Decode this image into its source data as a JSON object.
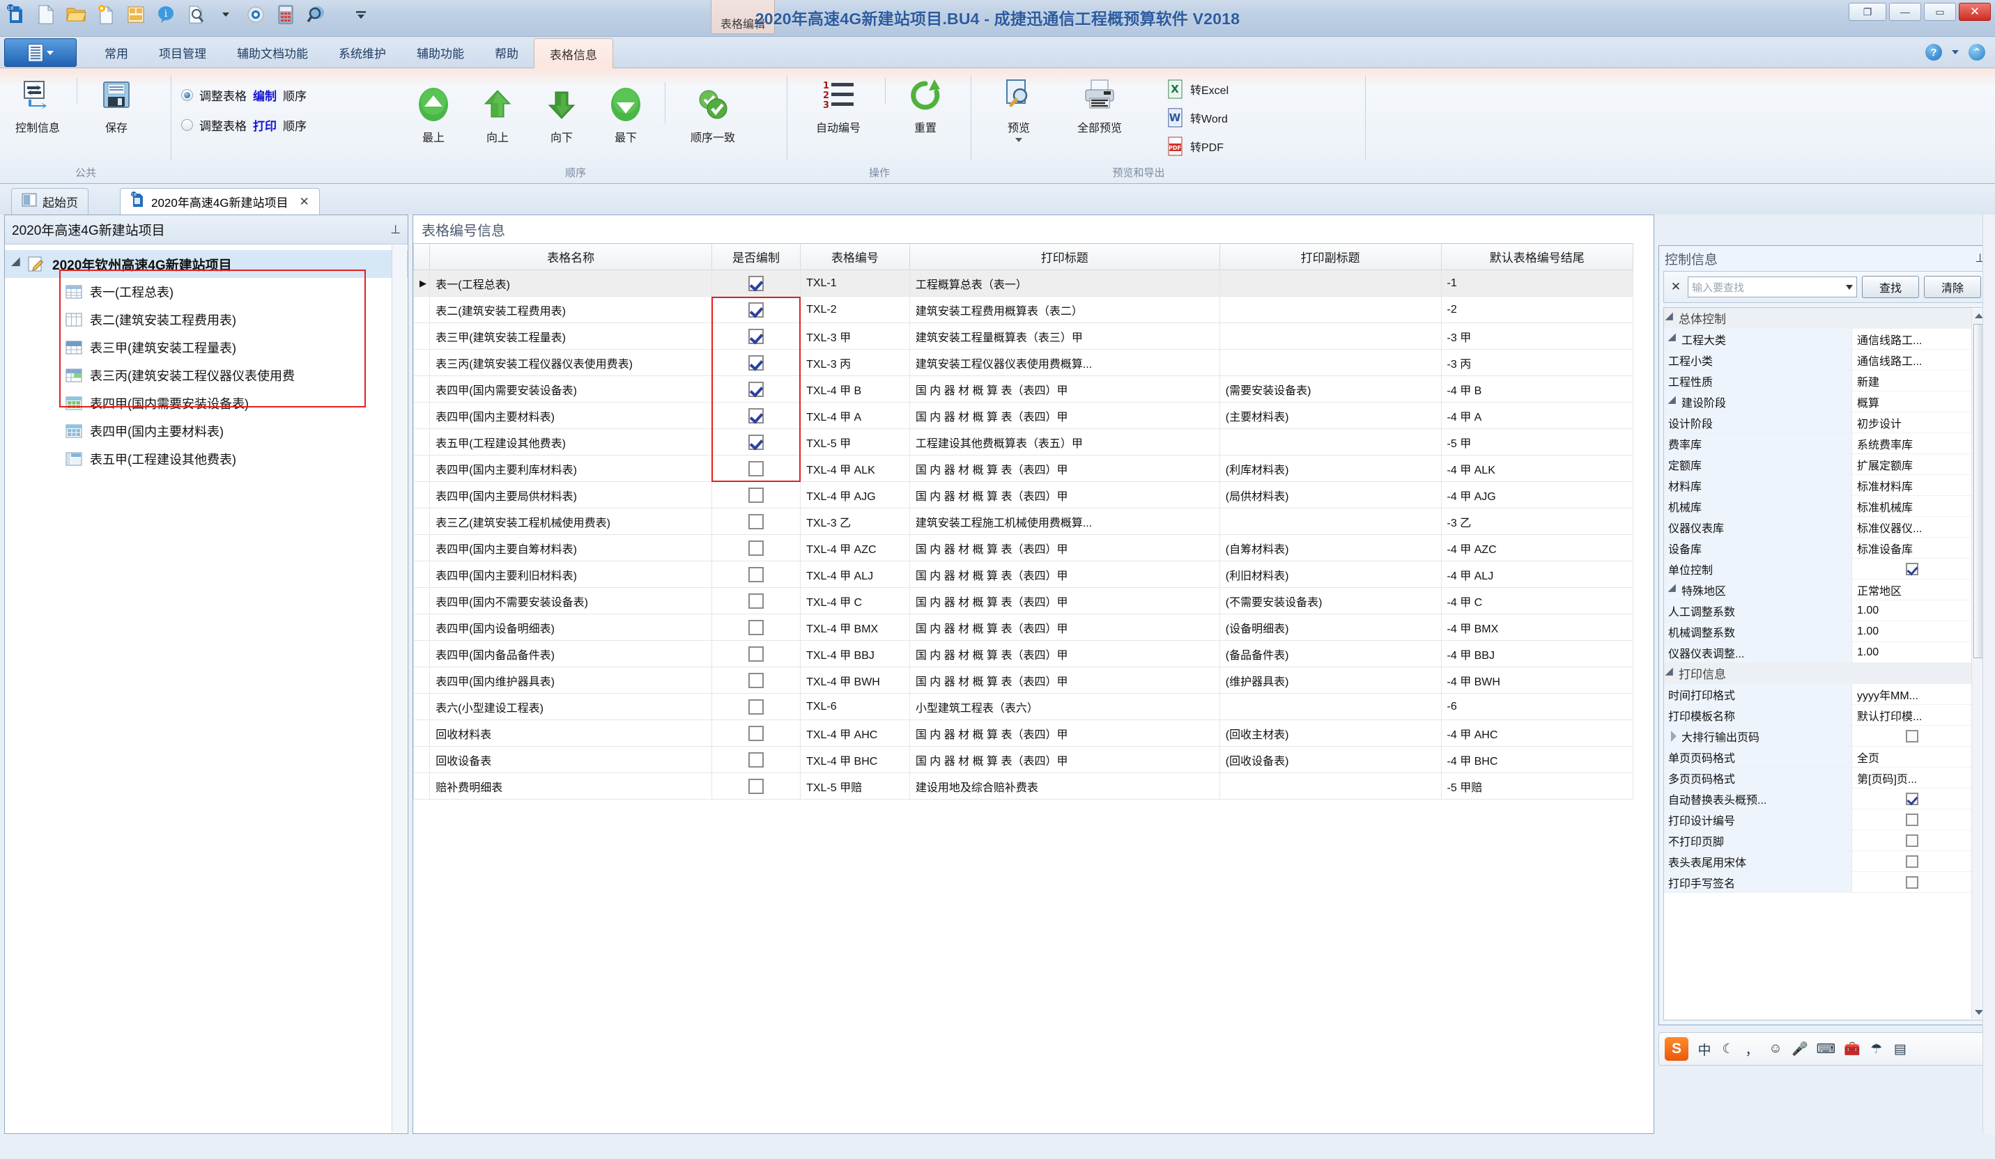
{
  "window": {
    "title": "2020年高速4G新建站项目.BU4 - 成捷迅通信工程概预算软件 V2018",
    "doc_tab_top": "表格编辑",
    "buttons": {
      "minimize": "—",
      "restore": "❐",
      "maximize": "▭",
      "close": "✕"
    }
  },
  "quick_access": {
    "icons": [
      "app-logo-icon",
      "new-file-icon",
      "open-folder-icon",
      "new-project-icon",
      "template-icon",
      "info-bubble-icon",
      "find-doc-icon",
      "dropdown-caret-icon",
      "settings-gear-icon",
      "calculator-icon",
      "search-magnifier-icon",
      "qat-more-icon"
    ]
  },
  "ribbon": {
    "tabs": [
      {
        "label": "常用",
        "active": false
      },
      {
        "label": "项目管理",
        "active": false
      },
      {
        "label": "辅助文档功能",
        "active": false
      },
      {
        "label": "系统维护",
        "active": false
      },
      {
        "label": "辅助功能",
        "active": false
      },
      {
        "label": "帮助",
        "active": false
      },
      {
        "label": "表格信息",
        "active": true
      }
    ],
    "help_icons": [
      "help-icon",
      "dropdown-caret-icon",
      "pin-ribbon-icon"
    ],
    "groups": [
      {
        "name": "公共",
        "buttons": [
          {
            "label": "控制信息",
            "icon": "control-info-icon"
          },
          {
            "label": "保存",
            "icon": "save-floppy-icon"
          }
        ]
      },
      {
        "name": "顺序",
        "radios": [
          {
            "prefix": "调整表格",
            "highlight": "编制",
            "suffix": "顺序",
            "checked": true
          },
          {
            "prefix": "调整表格",
            "highlight": "打印",
            "suffix": "顺序",
            "checked": false
          }
        ],
        "buttons": [
          {
            "label": "最上",
            "icon": "move-top-icon"
          },
          {
            "label": "向上",
            "icon": "move-up-icon"
          },
          {
            "label": "向下",
            "icon": "move-down-icon"
          },
          {
            "label": "最下",
            "icon": "move-bottom-icon"
          },
          {
            "label": "顺序一致",
            "icon": "sync-order-icon"
          }
        ]
      },
      {
        "name": "操作",
        "buttons": [
          {
            "label": "自动编号",
            "icon": "auto-number-icon"
          },
          {
            "label": "重置",
            "icon": "reset-refresh-icon"
          }
        ]
      },
      {
        "name": "预览和导出",
        "buttons": [
          {
            "label": "预览",
            "icon": "preview-icon"
          },
          {
            "label": "全部预览",
            "icon": "preview-all-printer-icon"
          }
        ],
        "exports": [
          {
            "label": "转Excel",
            "icon": "excel-icon"
          },
          {
            "label": "转Word",
            "icon": "word-icon"
          },
          {
            "label": "转PDF",
            "icon": "pdf-icon"
          }
        ]
      }
    ]
  },
  "doc_tabs": [
    {
      "label": "起始页",
      "icon": "start-page-icon",
      "active": false,
      "closable": false
    },
    {
      "label": "2020年高速4G新建站项目",
      "icon": "project-icon",
      "active": true,
      "closable": true,
      "close_glyph": "✕"
    }
  ],
  "left_panel": {
    "header": "2020年高速4G新建站项目",
    "pin_glyph": "⊥",
    "root": {
      "label": "2020年钦州高速4G新建站项目",
      "icon": "project-edit-icon"
    },
    "items": [
      {
        "label": "表一(工程总表)",
        "icon": "table-grid-blue-icon"
      },
      {
        "label": "表二(建筑安装工程费用表)",
        "icon": "table-columns-icon"
      },
      {
        "label": "表三甲(建筑安装工程量表)",
        "icon": "table-header-blue-icon"
      },
      {
        "label": "表三丙(建筑安装工程仪器仪表使用费",
        "icon": "table-mixed-green-icon"
      },
      {
        "label": "表四甲(国内需要安装设备表)",
        "icon": "table-green-icon"
      },
      {
        "label": "表四甲(国内主要材料表)",
        "icon": "table-blue-icon"
      },
      {
        "label": "表五甲(工程建设其他费表)",
        "icon": "table-form-icon"
      }
    ]
  },
  "grid": {
    "title": "表格编号信息",
    "columns": [
      "",
      "表格名称",
      "是否编制",
      "表格编号",
      "打印标题",
      "打印副标题",
      "默认表格编号结尾"
    ],
    "rows": [
      {
        "ind": "▶",
        "name": "表一(工程总表)",
        "checked": true,
        "num": "TXL-1",
        "title": "工程概算总表（表一）",
        "sub": "",
        "tail": "-1",
        "selected": true
      },
      {
        "ind": "",
        "name": "表二(建筑安装工程费用表)",
        "checked": true,
        "num": "TXL-2",
        "title": "建筑安装工程费用概算表（表二）",
        "sub": "",
        "tail": "-2",
        "selected": false
      },
      {
        "ind": "",
        "name": "表三甲(建筑安装工程量表)",
        "checked": true,
        "num": "TXL-3 甲",
        "title": "建筑安装工程量概算表（表三）甲",
        "sub": "",
        "tail": "-3 甲",
        "selected": false
      },
      {
        "ind": "",
        "name": "表三丙(建筑安装工程仪器仪表使用费表)",
        "checked": true,
        "num": "TXL-3 丙",
        "title": "建筑安装工程仪器仪表使用费概算...",
        "sub": "",
        "tail": "-3 丙",
        "selected": false
      },
      {
        "ind": "",
        "name": "表四甲(国内需要安装设备表)",
        "checked": true,
        "num": "TXL-4 甲 B",
        "title": "国 内 器 材 概 算 表（表四）甲",
        "sub": "(需要安装设备表)",
        "tail": "-4 甲 B",
        "selected": false
      },
      {
        "ind": "",
        "name": "表四甲(国内主要材料表)",
        "checked": true,
        "num": "TXL-4 甲 A",
        "title": "国 内 器 材 概 算 表（表四）甲",
        "sub": "(主要材料表)",
        "tail": "-4 甲 A",
        "selected": false
      },
      {
        "ind": "",
        "name": "表五甲(工程建设其他费表)",
        "checked": true,
        "num": "TXL-5 甲",
        "title": "工程建设其他费概算表（表五）甲",
        "sub": "",
        "tail": "-5 甲",
        "selected": false
      },
      {
        "ind": "",
        "name": "表四甲(国内主要利库材料表)",
        "checked": false,
        "num": "TXL-4 甲 ALK",
        "title": "国 内 器 材 概 算 表（表四）甲",
        "sub": "(利库材料表)",
        "tail": "-4 甲 ALK",
        "selected": false
      },
      {
        "ind": "",
        "name": "表四甲(国内主要局供材料表)",
        "checked": false,
        "num": "TXL-4 甲 AJG",
        "title": "国 内 器 材 概 算 表（表四）甲",
        "sub": "(局供材料表)",
        "tail": "-4 甲 AJG",
        "selected": false
      },
      {
        "ind": "",
        "name": "表三乙(建筑安装工程机械使用费表)",
        "checked": false,
        "num": "TXL-3 乙",
        "title": "建筑安装工程施工机械使用费概算...",
        "sub": "",
        "tail": "-3 乙",
        "selected": false
      },
      {
        "ind": "",
        "name": "表四甲(国内主要自筹材料表)",
        "checked": false,
        "num": "TXL-4 甲 AZC",
        "title": "国 内 器 材 概 算 表（表四）甲",
        "sub": "(自筹材料表)",
        "tail": "-4 甲 AZC",
        "selected": false
      },
      {
        "ind": "",
        "name": "表四甲(国内主要利旧材料表)",
        "checked": false,
        "num": "TXL-4 甲 ALJ",
        "title": "国 内 器 材 概 算 表（表四）甲",
        "sub": "(利旧材料表)",
        "tail": "-4 甲 ALJ",
        "selected": false
      },
      {
        "ind": "",
        "name": "表四甲(国内不需要安装设备表)",
        "checked": false,
        "num": "TXL-4 甲 C",
        "title": "国 内 器 材 概 算 表（表四）甲",
        "sub": "(不需要安装设备表)",
        "tail": "-4 甲 C",
        "selected": false
      },
      {
        "ind": "",
        "name": "表四甲(国内设备明细表)",
        "checked": false,
        "num": "TXL-4 甲 BMX",
        "title": "国 内 器 材 概 算 表（表四）甲",
        "sub": "(设备明细表)",
        "tail": "-4 甲 BMX",
        "selected": false
      },
      {
        "ind": "",
        "name": "表四甲(国内备品备件表)",
        "checked": false,
        "num": "TXL-4 甲 BBJ",
        "title": "国 内 器 材 概 算 表（表四）甲",
        "sub": "(备品备件表)",
        "tail": "-4 甲 BBJ",
        "selected": false
      },
      {
        "ind": "",
        "name": "表四甲(国内维护器具表)",
        "checked": false,
        "num": "TXL-4 甲 BWH",
        "title": "国 内 器 材 概 算 表（表四）甲",
        "sub": "(维护器具表)",
        "tail": "-4 甲 BWH",
        "selected": false
      },
      {
        "ind": "",
        "name": "表六(小型建设工程表)",
        "checked": false,
        "num": "TXL-6",
        "title": "小型建筑工程表（表六）",
        "sub": "",
        "tail": "-6",
        "selected": false
      },
      {
        "ind": "",
        "name": "回收材料表",
        "checked": false,
        "num": "TXL-4 甲 AHC",
        "title": "国 内 器 材 概 算 表（表四）甲",
        "sub": "(回收主材表)",
        "tail": "-4 甲 AHC",
        "selected": false
      },
      {
        "ind": "",
        "name": "回收设备表",
        "checked": false,
        "num": "TXL-4 甲 BHC",
        "title": "国 内 器 材 概 算 表（表四）甲",
        "sub": "(回收设备表)",
        "tail": "-4 甲 BHC",
        "selected": false
      },
      {
        "ind": "",
        "name": "赔补费明细表",
        "checked": false,
        "num": "TXL-5 甲赔",
        "title": "建设用地及综合赔补费表",
        "sub": "",
        "tail": "-5 甲赔",
        "selected": false
      }
    ]
  },
  "right_panel": {
    "header": "控制信息",
    "pin_glyph": "⊥",
    "search": {
      "close_glyph": "✕",
      "placeholder": "输入要查找",
      "find_label": "查找",
      "clear_label": "清除"
    },
    "groups": [
      {
        "label": "总体控制",
        "rows": [
          {
            "label": "工程大类",
            "value": "通信线路工...",
            "indent": 1,
            "expander": "expanded",
            "type": "text"
          },
          {
            "label": "工程小类",
            "value": "通信线路工...",
            "indent": 2,
            "type": "text"
          },
          {
            "label": "工程性质",
            "value": "新建",
            "indent": 1,
            "type": "text"
          },
          {
            "label": "建设阶段",
            "value": "概算",
            "indent": 1,
            "expander": "expanded",
            "type": "text"
          },
          {
            "label": "设计阶段",
            "value": "初步设计",
            "indent": 2,
            "type": "text"
          },
          {
            "label": "费率库",
            "value": "系统费率库",
            "indent": 1,
            "type": "text"
          },
          {
            "label": "定额库",
            "value": "扩展定额库",
            "indent": 1,
            "type": "text"
          },
          {
            "label": "材料库",
            "value": "标准材料库",
            "indent": 1,
            "type": "text"
          },
          {
            "label": "机械库",
            "value": "标准机械库",
            "indent": 1,
            "type": "text"
          },
          {
            "label": "仪器仪表库",
            "value": "标准仪器仪...",
            "indent": 1,
            "type": "text"
          },
          {
            "label": "设备库",
            "value": "标准设备库",
            "indent": 1,
            "type": "text"
          },
          {
            "label": "单位控制",
            "value": "",
            "indent": 1,
            "type": "checkbox",
            "checked": true
          },
          {
            "label": "特殊地区",
            "value": "正常地区",
            "indent": 1,
            "expander": "expanded",
            "type": "text"
          },
          {
            "label": "人工调整系数",
            "value": "1.00",
            "indent": 2,
            "type": "text"
          },
          {
            "label": "机械调整系数",
            "value": "1.00",
            "indent": 2,
            "type": "text"
          },
          {
            "label": "仪器仪表调整...",
            "value": "1.00",
            "indent": 2,
            "type": "text"
          }
        ]
      },
      {
        "label": "打印信息",
        "rows": [
          {
            "label": "时间打印格式",
            "value": "yyyy年MM...",
            "indent": 1,
            "type": "text"
          },
          {
            "label": "打印模板名称",
            "value": "默认打印模...",
            "indent": 1,
            "type": "text"
          },
          {
            "label": "大排行输出页码",
            "value": "",
            "indent": 1,
            "expander": "collapsed",
            "type": "checkbox",
            "checked": false
          },
          {
            "label": "单页页码格式",
            "value": "全页",
            "indent": 1,
            "type": "text"
          },
          {
            "label": "多页页码格式",
            "value": "第[页码]页...",
            "indent": 1,
            "type": "text"
          },
          {
            "label": "自动替换表头概预...",
            "value": "",
            "indent": 1,
            "type": "checkbox",
            "checked": true
          },
          {
            "label": "打印设计编号",
            "value": "",
            "indent": 1,
            "type": "checkbox",
            "checked": false
          },
          {
            "label": "不打印页脚",
            "value": "",
            "indent": 1,
            "type": "checkbox",
            "checked": false
          },
          {
            "label": "表头表尾用宋体",
            "value": "",
            "indent": 1,
            "type": "checkbox",
            "checked": false
          },
          {
            "label": "打印手写签名",
            "value": "",
            "indent": 1,
            "type": "checkbox",
            "checked": false
          }
        ]
      }
    ]
  },
  "ime_bar": {
    "logo": "S",
    "items": [
      "中",
      "moon-icon",
      "comma-icon",
      "smiley-icon",
      "microphone-icon",
      "keyboard-icon",
      "toolbox-icon",
      "umbrella-icon",
      "menu-icon"
    ]
  },
  "colors": {
    "accent": "#2c5b9e",
    "highlight_red": "#e41f1f",
    "radio_highlight": "#1414d2",
    "selection": "#d6e7f5"
  }
}
